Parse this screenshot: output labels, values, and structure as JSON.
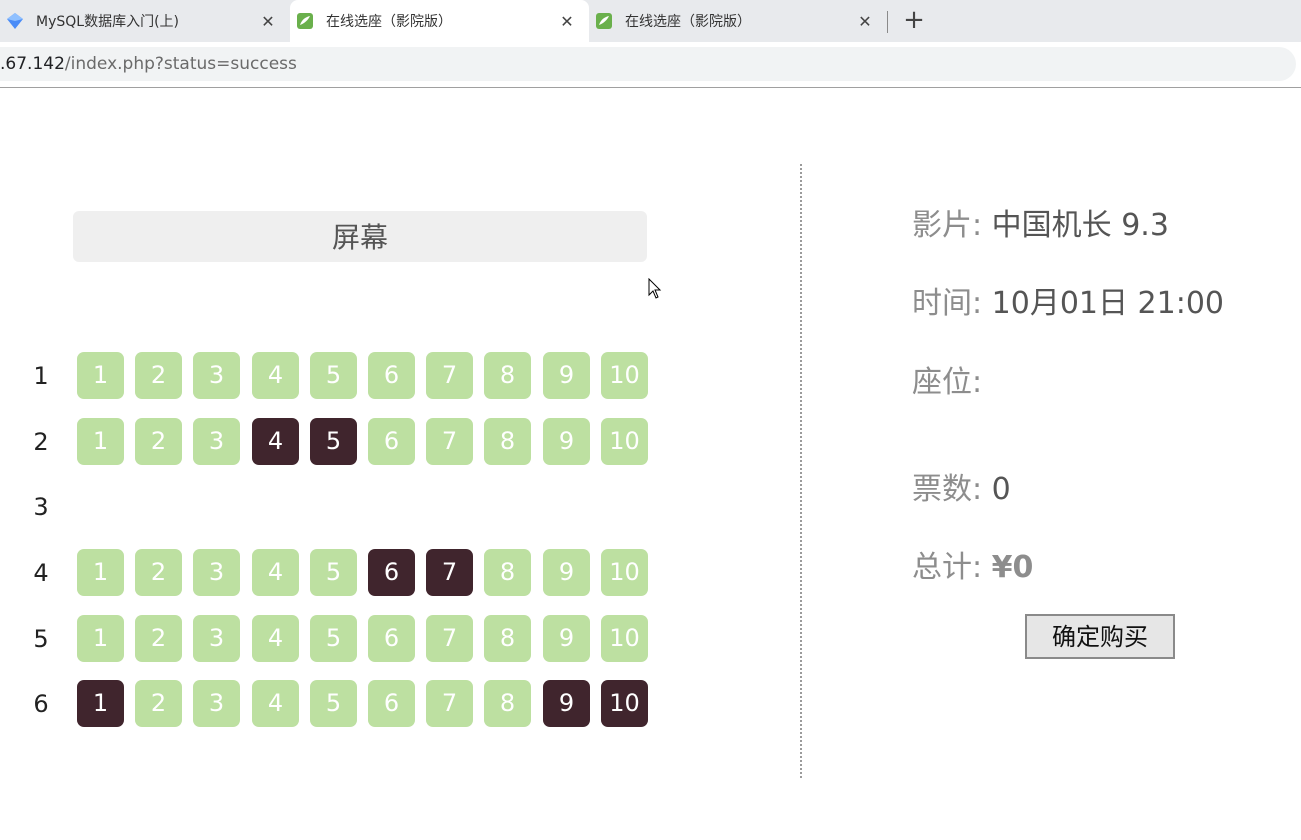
{
  "browser": {
    "tabs": [
      {
        "title": "MySQL数据库入门(上)",
        "icon": "diamond-logo-icon",
        "active": false
      },
      {
        "title": "在线选座（影院版）",
        "icon": "leaf-logo-icon",
        "active": true
      },
      {
        "title": "在线选座（影院版）",
        "icon": "leaf-logo-icon",
        "active": false
      }
    ],
    "close_glyph": "✕",
    "new_tab_glyph": "+",
    "url_host": ".67.142",
    "url_path": "/index.php?status=success"
  },
  "cinema": {
    "screen_label": "屏幕",
    "rows": [
      {
        "label": "1",
        "seats": [
          "1",
          "2",
          "3",
          "4",
          "5",
          "6",
          "7",
          "8",
          "9",
          "10"
        ],
        "sold": []
      },
      {
        "label": "2",
        "seats": [
          "1",
          "2",
          "3",
          "4",
          "5",
          "6",
          "7",
          "8",
          "9",
          "10"
        ],
        "sold": [
          "4",
          "5"
        ]
      },
      {
        "label": "3",
        "seats": [],
        "sold": []
      },
      {
        "label": "4",
        "seats": [
          "1",
          "2",
          "3",
          "4",
          "5",
          "6",
          "7",
          "8",
          "9",
          "10"
        ],
        "sold": [
          "6",
          "7"
        ]
      },
      {
        "label": "5",
        "seats": [
          "1",
          "2",
          "3",
          "4",
          "5",
          "6",
          "7",
          "8",
          "9",
          "10"
        ],
        "sold": []
      },
      {
        "label": "6",
        "seats": [
          "1",
          "2",
          "3",
          "4",
          "5",
          "6",
          "7",
          "8",
          "9",
          "10"
        ],
        "sold": [
          "1",
          "9",
          "10"
        ]
      }
    ],
    "colors": {
      "available": "#bde0a1",
      "sold": "#40252d"
    }
  },
  "info": {
    "movie_label": "影片:",
    "movie_value": "中国机长 9.3",
    "time_label": "时间:",
    "time_value": "10月01日 21:00",
    "seat_label": "座位:",
    "tickets_label": "票数:",
    "tickets_value": "0",
    "total_label": "总计:",
    "currency": "¥",
    "total_value": "0",
    "buy_button": "确定购买"
  }
}
